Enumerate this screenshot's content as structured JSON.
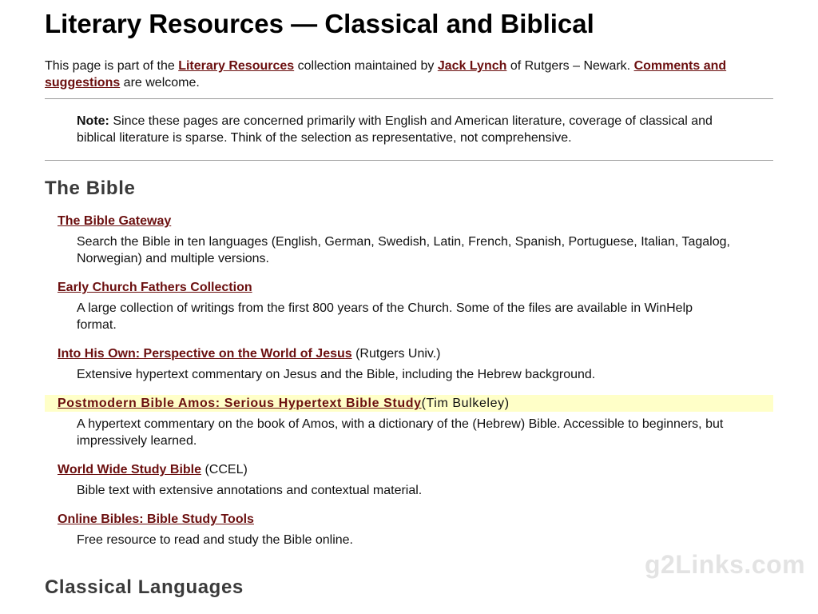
{
  "page_title": "Literary Resources — Classical and Biblical",
  "intro": {
    "t1": "This page is part of the ",
    "link1": "Literary Resources",
    "t2": " collection maintained by ",
    "link2": "Jack Lynch",
    "t3": " of Rutgers – Newark. ",
    "link3": "Comments and suggestions",
    "t4": " are welcome."
  },
  "note": {
    "label": "Note:",
    "text": " Since these pages are concerned primarily with English and American literature, coverage of classical and biblical literature is sparse. Think of the selection as representative, not comprehensive."
  },
  "sections": {
    "bible": "The Bible",
    "classical": "Classical Languages"
  },
  "entries": [
    {
      "title": "The Bible Gateway",
      "extra": "",
      "desc": "Search the Bible in ten languages (English, German, Swedish, Latin, French, Spanish, Portuguese, Italian, Tagalog, Norwegian) and multiple versions."
    },
    {
      "title": "Early Church Fathers Collection",
      "extra": "",
      "desc": "A large collection of writings from the first 800 years of the Church. Some of the files are available in WinHelp format."
    },
    {
      "title": "Into His Own: Perspective on the World of Jesus",
      "extra": " (Rutgers Univ.)",
      "desc": "Extensive hypertext commentary on Jesus and the Bible, including the Hebrew background."
    },
    {
      "title": "Postmodern Bible Amos: Serious Hypertext Bible Study",
      "extra": "(Tim Bulkeley)",
      "desc": "A hypertext commentary on the book of Amos, with a dictionary of the (Hebrew) Bible. Accessible to beginners, but impressively learned."
    },
    {
      "title": "World Wide Study Bible",
      "extra": " (CCEL)",
      "desc": "Bible text with extensive annotations and contextual material."
    },
    {
      "title": "Online Bibles: Bible Study Tools",
      "extra": "",
      "desc": "Free resource to read and study the Bible online."
    }
  ],
  "watermark": "g2Links.com",
  "colors": {
    "link": "#6b0f0f",
    "highlight": "#ffffc8",
    "heading2": "#3a3a3a"
  }
}
